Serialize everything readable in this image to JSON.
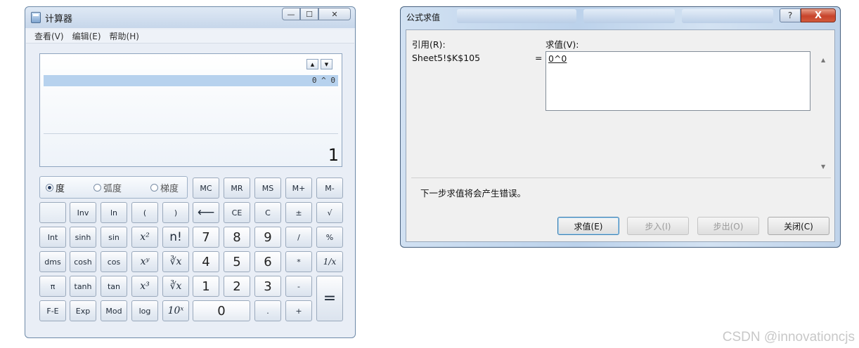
{
  "calculator": {
    "title": "计算器",
    "window_buttons": {
      "minimize": "—",
      "maximize": "☐",
      "close": "✕"
    },
    "menu": [
      "查看(V)",
      "编辑(E)",
      "帮助(H)"
    ],
    "display": {
      "history_expression": "0 ^ 0",
      "value": "1",
      "scroll_up": "▲",
      "scroll_down": "▼"
    },
    "angle_modes": {
      "selected": "度",
      "options": [
        "度",
        "弧度",
        "梯度"
      ]
    },
    "memory_keys": [
      "MC",
      "MR",
      "MS",
      "M+",
      "M-"
    ],
    "keys": {
      "r1": [
        "",
        "Inv",
        "ln",
        "(",
        ")",
        "⟵",
        "CE",
        "C",
        "±",
        "√"
      ],
      "r2": [
        "Int",
        "sinh",
        "sin",
        "x²",
        "n!",
        "7",
        "8",
        "9",
        "/",
        "%"
      ],
      "r3": [
        "dms",
        "cosh",
        "cos",
        "xʸ",
        "∛x",
        "4",
        "5",
        "6",
        "*",
        "1/x"
      ],
      "r4": [
        "π",
        "tanh",
        "tan",
        "x³",
        "∛x",
        "1",
        "2",
        "3",
        "-",
        "="
      ],
      "r5": [
        "F-E",
        "Exp",
        "Mod",
        "log",
        "10ˣ",
        "0",
        ".",
        "+"
      ]
    }
  },
  "dialog": {
    "title": "公式求值",
    "help": "?",
    "close": "X",
    "reference_label": "引用(R):",
    "evaluation_label": "求值(V):",
    "reference": "Sheet5!$K$105",
    "equals": "=",
    "evaluation": "0^0",
    "scroll_up": "▲",
    "scroll_down": "▼",
    "message": "下一步求值将会产生错误。",
    "buttons": {
      "evaluate": "求值(E)",
      "step_in": "步入(I)",
      "step_out": "步出(O)",
      "close": "关闭(C)"
    }
  },
  "watermark": "CSDN @innovationcjs"
}
